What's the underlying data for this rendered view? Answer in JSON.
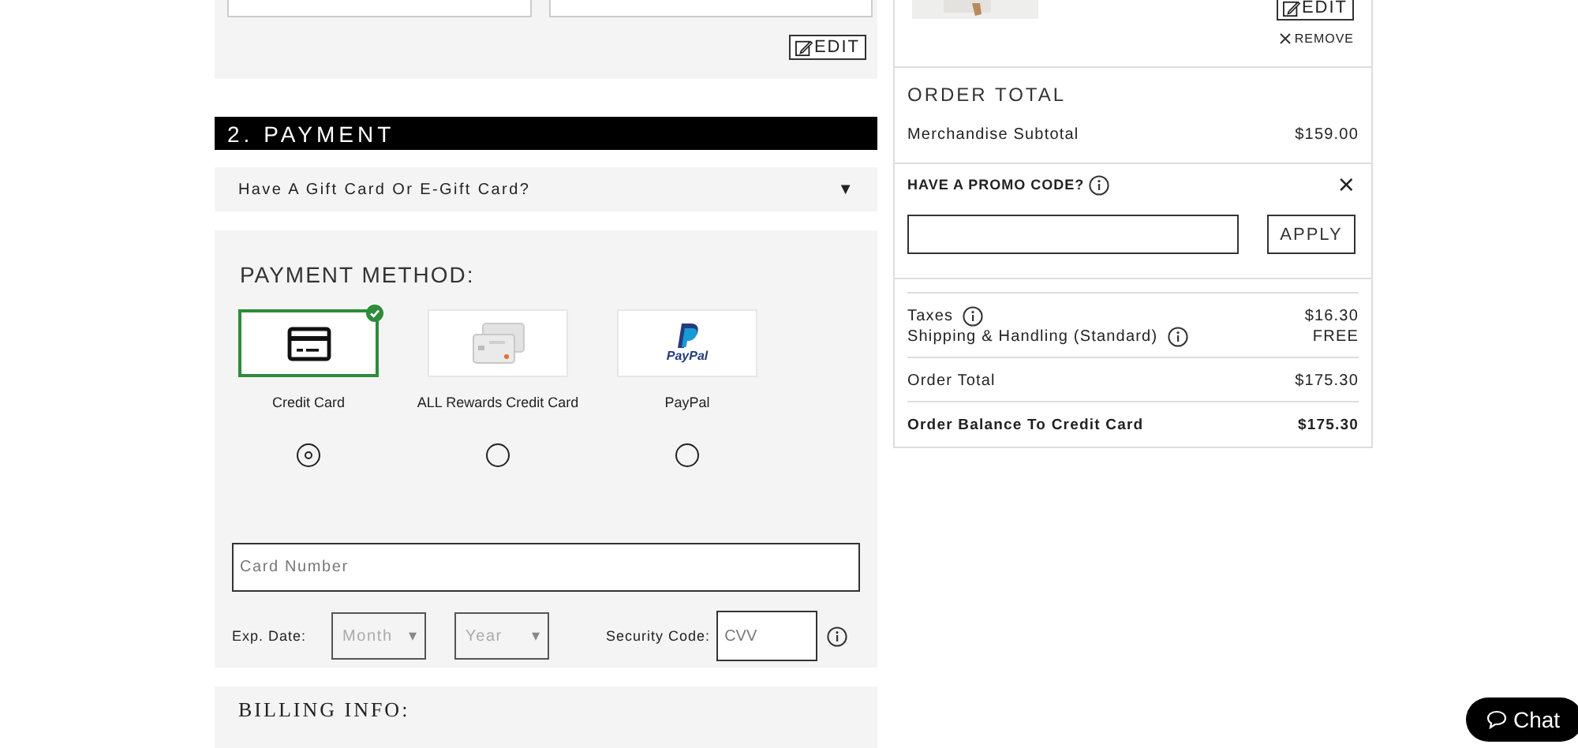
{
  "shipping": {
    "edit_button": "EDIT"
  },
  "payment": {
    "heading": "2. PAYMENT",
    "gift_card": {
      "label": "Have A Gift Card Or E-Gift Card?",
      "toggle": "▼",
      "expanded": false
    },
    "method_title": "PAYMENT METHOD:",
    "methods": [
      {
        "kind": "credit-card",
        "label": "Credit Card",
        "selected": true
      },
      {
        "kind": "rewards-card",
        "label": "ALL Rewards Credit Card",
        "selected": false
      },
      {
        "kind": "paypal",
        "label": "PayPal",
        "logo_text": "PayPal",
        "selected": false
      }
    ],
    "card_number": {
      "placeholder": "Card Number"
    },
    "exp_label": "Exp. Date:",
    "month": {
      "placeholder": "Month",
      "toggle": "▾"
    },
    "year": {
      "placeholder": "Year",
      "toggle": "▾"
    },
    "security_label": "Security Code:",
    "cvv": {
      "placeholder": "CVV"
    }
  },
  "billing": {
    "heading": "BILLING INFO:"
  },
  "cart_item": {
    "edit_button": "EDIT",
    "remove_link": "REMOVE"
  },
  "order_total": {
    "heading": "ORDER TOTAL",
    "subtotal_label": "Merchandise Subtotal",
    "subtotal": "$159.00",
    "promo": {
      "label": "HAVE A PROMO CODE?",
      "apply_button": "APPLY",
      "close": "×"
    },
    "groups": [
      {
        "lines": [
          {
            "label": "Taxes",
            "value": "$16.30",
            "info": true,
            "bold": false
          },
          {
            "label": "Shipping & Handling (Standard)",
            "value": "FREE",
            "info": true,
            "bold": false
          }
        ]
      },
      {
        "lines": [
          {
            "label": "Order Total",
            "value": "$175.30",
            "info": false,
            "bold": false
          }
        ]
      },
      {
        "lines": [
          {
            "label": "Order Balance To Credit Card",
            "value": "$175.30",
            "info": false,
            "bold": true
          }
        ]
      }
    ]
  },
  "chat_button": "Chat"
}
